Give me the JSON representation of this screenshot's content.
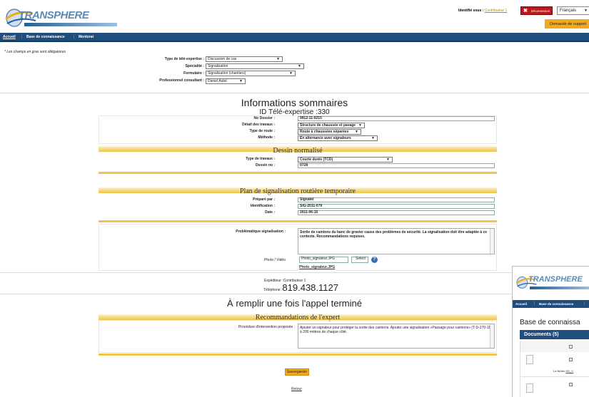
{
  "header": {
    "logo_text": "TRANSPHERE",
    "identity_label": "Identifié sous :",
    "identity_user": "Contributeur 1",
    "logout_label": "Déconnexion",
    "language": "Français",
    "support_label": "Demande de support"
  },
  "nav": {
    "items": [
      "Accueil",
      "Base de connaissance",
      "Mentorat"
    ]
  },
  "form": {
    "required_note": "* Les champs en gras sont obligatoires",
    "type_label": "Type de télé-expertise :",
    "type_value": "Discussion de cas",
    "specialite_label": "Spécialité :",
    "specialite_value": "Signalisation",
    "formulaire_label": "Formulaire :",
    "formulaire_value": "Signalisation (chantiers)",
    "consultant_label": "Professionnel consultant :",
    "consultant_value": "Daniel Aubé"
  },
  "summary": {
    "title": "Informations sommaires",
    "id_line": "ID Télé-expertise :330",
    "dossier_label": "No Dossier :",
    "dossier_value": "9912-11-0215",
    "travaux_label": "Détail des travaux :",
    "travaux_value": "Structure de chaussée et pavage",
    "route_label": "Type de route :",
    "route_value": "Route à chaussées séparées",
    "methode_label": "Méthode :",
    "methode_value": "En alternance avec signaleurs"
  },
  "dessin": {
    "title": "Dessin normalisé",
    "type_label": "Type de travaux :",
    "type_value": "Courte durée (TCD)",
    "no_label": "Dessin no :",
    "no_value": "0728"
  },
  "plan": {
    "title": "Plan de signalisation routière temporaire",
    "prepare_label": "Préparé par :",
    "prepare_value": "Signatel",
    "ident_label": "Identification :",
    "ident_value": "SIG-2011-079",
    "date_label": "Date :",
    "date_value": "2011-06-15",
    "prob_label": "Problématique signalisation :",
    "prob_text": "Sortie de camions du banc de gravier cause des problèmes de sécurité. La signalisation doit  être adaptée à ce contexte. Recommandations requises.",
    "photo_label": "Photo / Vidéo",
    "photo_file": "Photo_signaleur.JPG",
    "select_label": "Select",
    "photo_link": "Photo_signaleur.JPG"
  },
  "sender": {
    "exp_label": "Expéditeur :",
    "exp_value": "Contributeur 1",
    "tel_label": "Téléphone :",
    "tel_value": "819.438.1127"
  },
  "call": {
    "title": "À remplir une fois l'appel terminé",
    "reco_title": "Recommandations de l'expert",
    "proc_label": "Procédure d'intervention proposée :",
    "proc_text": "Ajouter un signaleur pour protéger la sortie des camions. Ajouter une signalisation  «Passage pour camions» (T-D-270-11) à 200 mètres de chaque côté."
  },
  "actions": {
    "save_label": "Sauvegarder",
    "back_label": "Retour"
  },
  "popup": {
    "logo_text": "TRANSPHERE",
    "nav": [
      "Accueil",
      "Base de connaissance"
    ],
    "title": "Base de connaissa",
    "docs_header": "Documents (5)",
    "file_label": "Le fichier",
    "file_link": "NB_G"
  },
  "colors": {
    "nav_blue": "#1f4d7d",
    "accent_orange": "#f3a91a",
    "band_gold": "#efc64a",
    "logout_red": "#c0161c"
  }
}
